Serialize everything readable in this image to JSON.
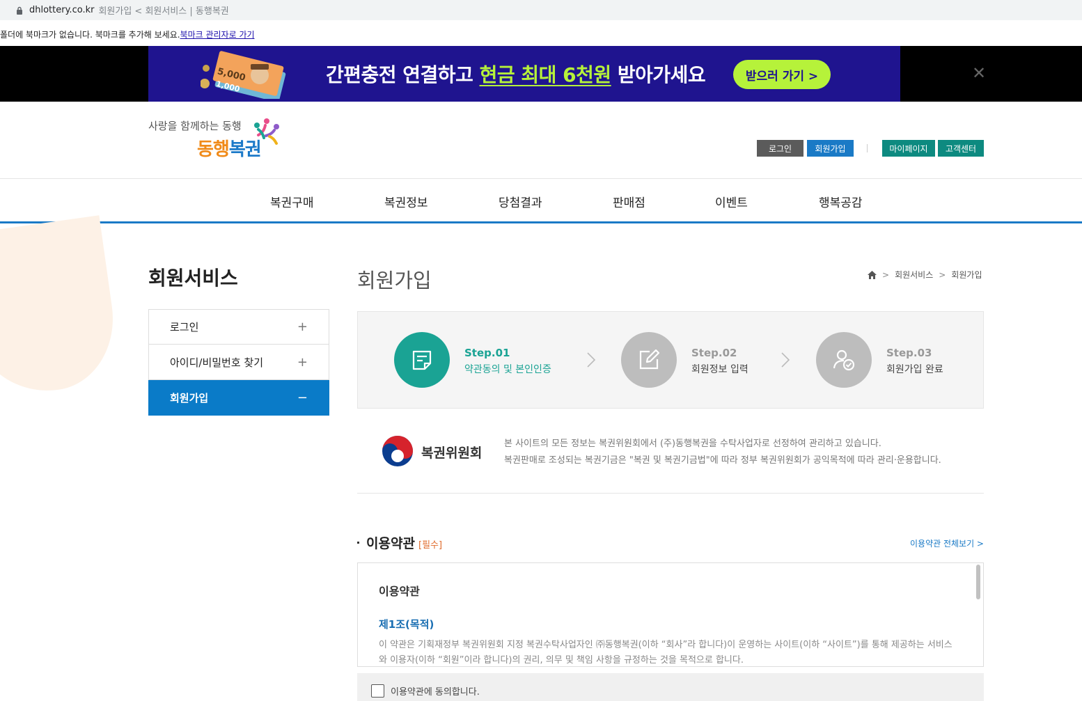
{
  "browser": {
    "domain": "dhlottery.co.kr",
    "tab_title": "회원가입 < 회원서비스 | 동행복권"
  },
  "bookmark_bar": {
    "message": "폴더에 북마크가 없습니다. 북마크를 추가해 보세요.",
    "link": "북마크 관리자로 가기"
  },
  "ad": {
    "text_before": "간편충전 연결하고 ",
    "text_highlight": "현금 최대 6천원",
    "text_after": " 받아가세요",
    "button_label": "받으러 가기 >",
    "close_label": "✕",
    "bill_label": "5,000",
    "bill_label_2": "1,000",
    "bg_color": "#1f148f",
    "accent_color": "#b6f23a"
  },
  "header": {
    "slogan": "사랑을 함께하는 동행",
    "logo_part1": "동행",
    "logo_part2": "복권",
    "login": "로그인",
    "join": "회원가입",
    "mypage": "마이페이지",
    "customer_center": "고객센터"
  },
  "gnb": {
    "items": [
      "복권구매",
      "복권정보",
      "당첨결과",
      "판매점",
      "이벤트",
      "행복공감"
    ]
  },
  "lnb": {
    "title": "회원서비스",
    "items": [
      {
        "label": "로그인",
        "sign": "+"
      },
      {
        "label": "아이디/비밀번호 찾기",
        "sign": "+"
      },
      {
        "label": "회원가입",
        "sign": "−"
      }
    ]
  },
  "content": {
    "page_title": "회원가입",
    "breadcrumb": [
      "회원서비스",
      "회원가입"
    ]
  },
  "steps": [
    {
      "num": "Step.01",
      "desc": "약관동의 및 본인인증",
      "icon": "document-icon"
    },
    {
      "num": "Step.02",
      "desc": "회원정보 입력",
      "icon": "edit-icon"
    },
    {
      "num": "Step.03",
      "desc": "회원가입 완료",
      "icon": "user-check-icon"
    }
  ],
  "commission": {
    "name": "복권위원회",
    "line1": "본 사이트의 모든 정보는 복권위원회에서 (주)동행복권을 수탁사업자로 선정하여 관리하고 있습니다.",
    "line2": "복권판매로 조성되는 복권기금은 \"복권 및 복권기금법\"에 따라 정부 복권위원회가 공익목적에 따라 관리·운용합니다."
  },
  "terms": {
    "section_title": "이용약관",
    "required": "[필수]",
    "view_all": "이용약관 전체보기 >",
    "box_title": "이용약관",
    "article_title": "제1조(목적)",
    "article_body": "이 약관은 기획재정부 복권위원회 지정 복권수탁사업자인 ㈜동행복권(이하 “회사”라 합니다)이 운영하는 사이트(이하 “사이트”)를 통해 제공하는 서비스와 이용자(이하 “회원”이라 합니다)의 권리, 의무 및 책임 사항을 규정하는 것을 목적으로 합니다.",
    "agree_label": "이용약관에 동의합니다."
  },
  "colors": {
    "primary_blue": "#1a7ac6",
    "teal": "#0d8a80",
    "step_active": "#1aa394"
  }
}
